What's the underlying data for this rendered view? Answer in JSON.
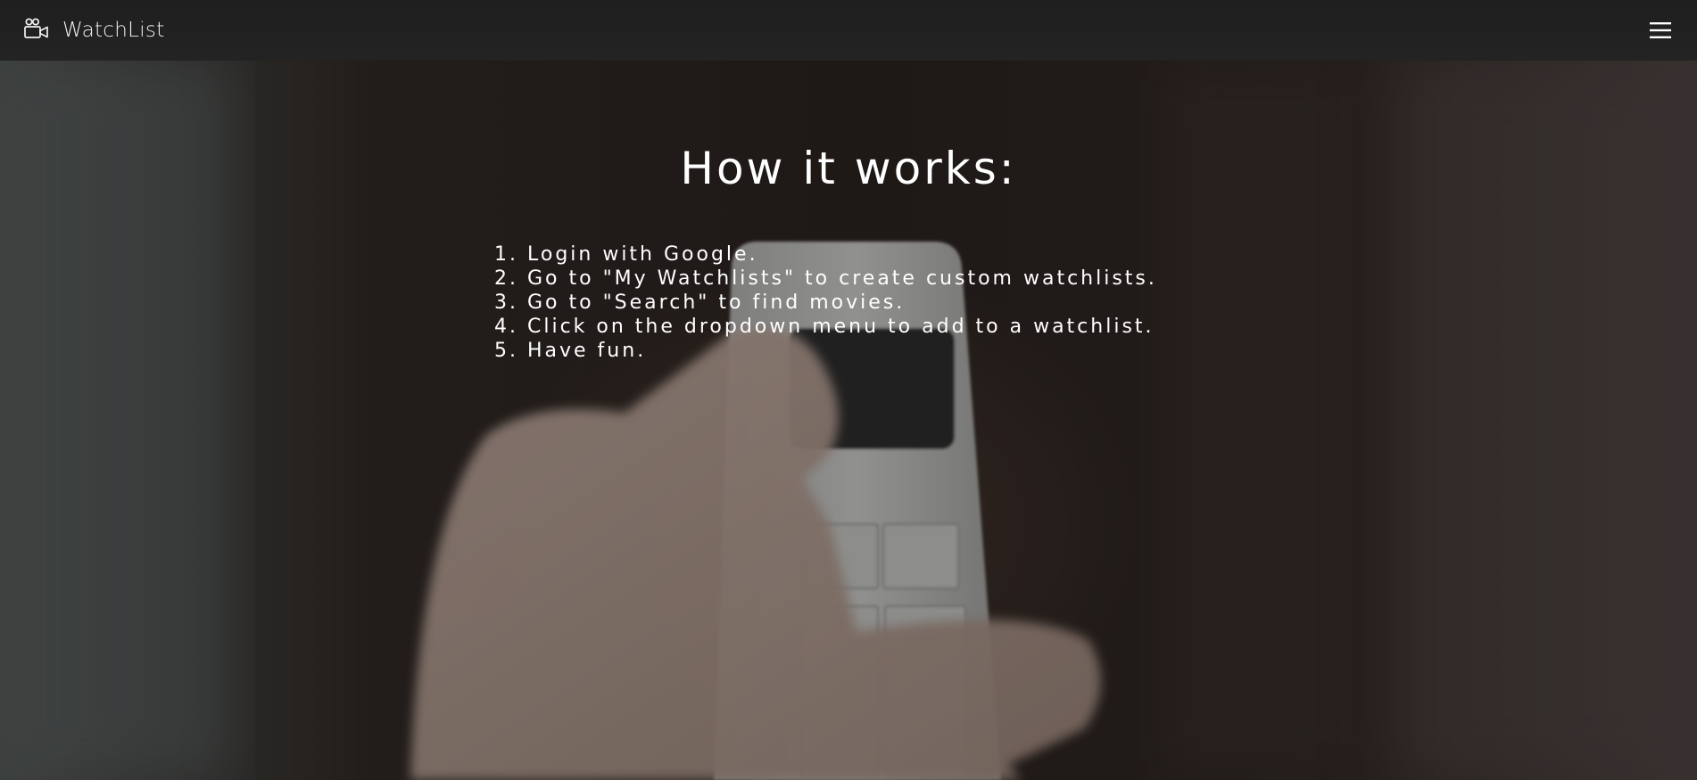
{
  "navbar": {
    "brand": "WatchList",
    "brand_icon": "video-camera-icon",
    "menu_icon": "hamburger-menu-icon"
  },
  "hero": {
    "background_image": "hand-holding-tv-remote-photo",
    "title": "How it works:",
    "steps": [
      "1. Login with Google.",
      "2. Go to \"My Watchlists\" to create custom watchlists.",
      "3. Go to \"Search\" to find movies.",
      "4. Click on the dropdown menu to add to a watchlist.",
      "5. Have fun."
    ]
  },
  "colors": {
    "navbar_bg": "#1f1f1f",
    "text": "#ffffff"
  }
}
